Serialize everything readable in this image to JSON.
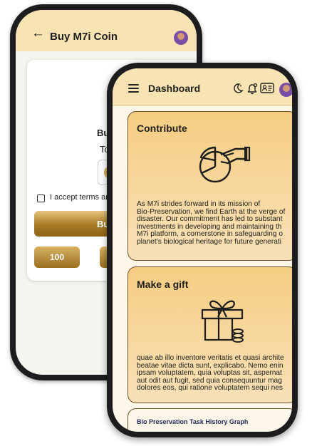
{
  "back_screen": {
    "header": {
      "title": "Buy M7i Coin"
    },
    "card": {
      "buy_label": "Buy M7",
      "total_label": "Total",
      "terms_label": "I accept terms and",
      "buy_button_label": "Buy",
      "amount_buttons": [
        "100",
        ""
      ]
    }
  },
  "front_screen": {
    "header": {
      "title": "Dashboard"
    },
    "contribute": {
      "title": "Contribute",
      "lines": [
        "As M7i strides forward in its mission of",
        "Bio-Preservation, we find Earth at the verge of",
        "disaster. Our commitment has led to substant",
        "investments in developing and maintaining th",
        "M7i platform, a cornerstone in safeguarding o",
        "planet's biological heritage for future generati"
      ]
    },
    "gift": {
      "title": "Make a gift",
      "lines": [
        "quae ab illo inventore veritatis et quasi archite",
        "beatae vitae dicta sunt, explicabo. Nemo enin",
        "ipsam voluptatem, quia voluptas sit, aspernat",
        "aut odit aut fugit, sed quia consequuntur mag",
        "dolores eos, qui ratione voluptatem sequi nes"
      ]
    },
    "graph_card": {
      "title": "Bio Preservation Task History Graph"
    }
  },
  "colors": {
    "header_bg": "#f8e4b2",
    "card_gradient_top": "#f6cd82",
    "card_border": "#6b5020",
    "gold_button": "#a77a22",
    "graph_title": "#222a5a"
  },
  "icons": [
    "back-arrow-icon",
    "avatar",
    "coin-icon",
    "menu-icon",
    "moon-icon",
    "bell-icon",
    "id-card-icon",
    "contribute-hand-chart-icon",
    "gift-icon"
  ]
}
